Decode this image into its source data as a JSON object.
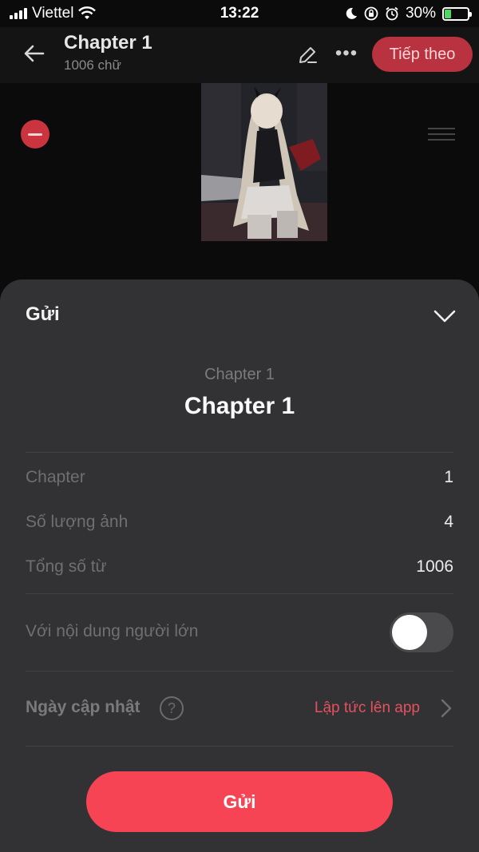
{
  "status_bar": {
    "carrier": "Viettel",
    "time": "13:22",
    "battery_percent": "30%",
    "battery_level": 0.3,
    "icons": [
      "signal-icon",
      "wifi-icon",
      "moon-icon",
      "rotation-lock-icon",
      "alarm-icon",
      "battery-charging-icon"
    ]
  },
  "header": {
    "title": "Chapter 1",
    "subtitle": "1006 chữ",
    "next_label": "Tiếp theo",
    "more_label": "•••",
    "accent_color": "#b8323f"
  },
  "sheet": {
    "title": "Gửi",
    "chapter_subtitle": "Chapter 1",
    "chapter_title": "Chapter 1",
    "rows": [
      {
        "label": "Chapter",
        "value": "1"
      },
      {
        "label": "Số lượng ảnh",
        "value": "4"
      },
      {
        "label": "Tổng số từ",
        "value": "1006"
      }
    ],
    "adult_label": "Với nội dung người lớn",
    "adult_enabled": false,
    "update_label": "Ngày cập nhật",
    "help_symbol": "?",
    "update_value": "Lập tức lên app",
    "submit_label": "Gửi",
    "submit_color": "#f74455"
  }
}
